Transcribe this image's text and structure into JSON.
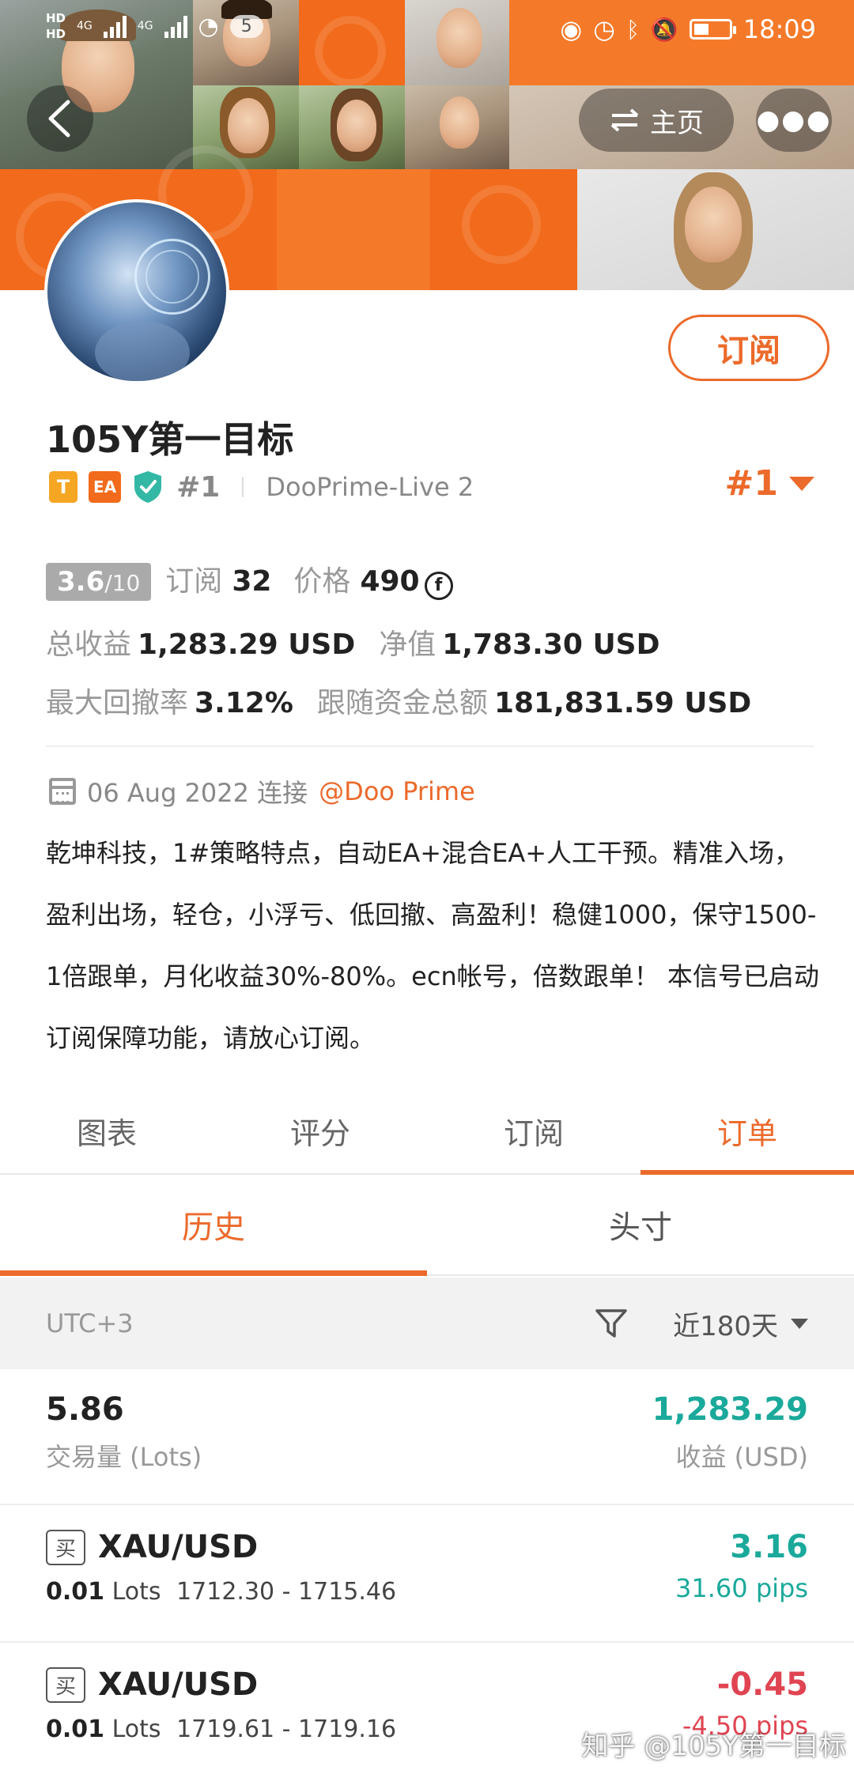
{
  "status_bar": {
    "network_1": "HD",
    "network_2": "HD",
    "signal_1": "4G",
    "signal_2": "4G",
    "notification_count": "5",
    "time": "18:09"
  },
  "nav": {
    "home_label": "主页"
  },
  "profile": {
    "name": "105Y第一目标",
    "tag_t": "T",
    "tag_ea": "EA",
    "rank_small": "#1",
    "server": "DooPrime-Live 2",
    "rank_big": "#1",
    "subscribe_label": "订阅"
  },
  "stats": {
    "score": "3.6",
    "score_total": "/10",
    "subscribe_label": "订阅",
    "subscribe_count": "32",
    "price_label": "价格",
    "price_value": "490",
    "price_coin": "f",
    "total_profit_label": "总收益",
    "total_profit_value": "1,283.29 USD",
    "equity_label": "净值",
    "equity_value": "1,783.30 USD",
    "max_drawdown_label": "最大回撤率",
    "max_drawdown_value": "3.12%",
    "follow_funds_label": "跟随资金总额",
    "follow_funds_value": "181,831.59 USD"
  },
  "connection": {
    "date": "06 Aug 2022 连接",
    "broker": "@Doo Prime"
  },
  "description": "乾坤科技，1#策略特点，自动EA+混合EA+人工干预。精准入场，盈利出场，轻仓，小浮亏、低回撤、高盈利！稳健1000，保守1500-1倍跟单，月化收益30%-80%。ecn帐号，倍数跟单！ 本信号已启动订阅保障功能，请放心订阅。",
  "tabs": [
    {
      "label": "图表"
    },
    {
      "label": "评分"
    },
    {
      "label": "订阅"
    },
    {
      "label": "订单"
    }
  ],
  "subtabs": [
    {
      "label": "历史"
    },
    {
      "label": "头寸"
    }
  ],
  "filter": {
    "timezone": "UTC+3",
    "period": "近180天"
  },
  "summary": {
    "volume_value": "5.86",
    "volume_label": "交易量 (Lots)",
    "profit_value": "1,283.29",
    "profit_label": "收益 (USD)"
  },
  "orders": [
    {
      "side": "买",
      "symbol": "XAU/USD",
      "lots": "0.01",
      "lots_unit": "Lots",
      "prices": "1712.30 - 1715.46",
      "pnl": "3.16",
      "pips": "31.60 pips",
      "pnl_color": "#1aa99b"
    },
    {
      "side": "买",
      "symbol": "XAU/USD",
      "lots": "0.01",
      "lots_unit": "Lots",
      "prices": "1719.61 - 1719.16",
      "pnl": "-0.45",
      "pips": "-4.50 pips",
      "pnl_color": "#e04452"
    }
  ],
  "watermark": "知乎 @105Y第一目标",
  "colors": {
    "accent": "#ec6a2b",
    "banner": "#f26a1b",
    "profit_green": "#1aa99b",
    "loss_red": "#e04452"
  }
}
